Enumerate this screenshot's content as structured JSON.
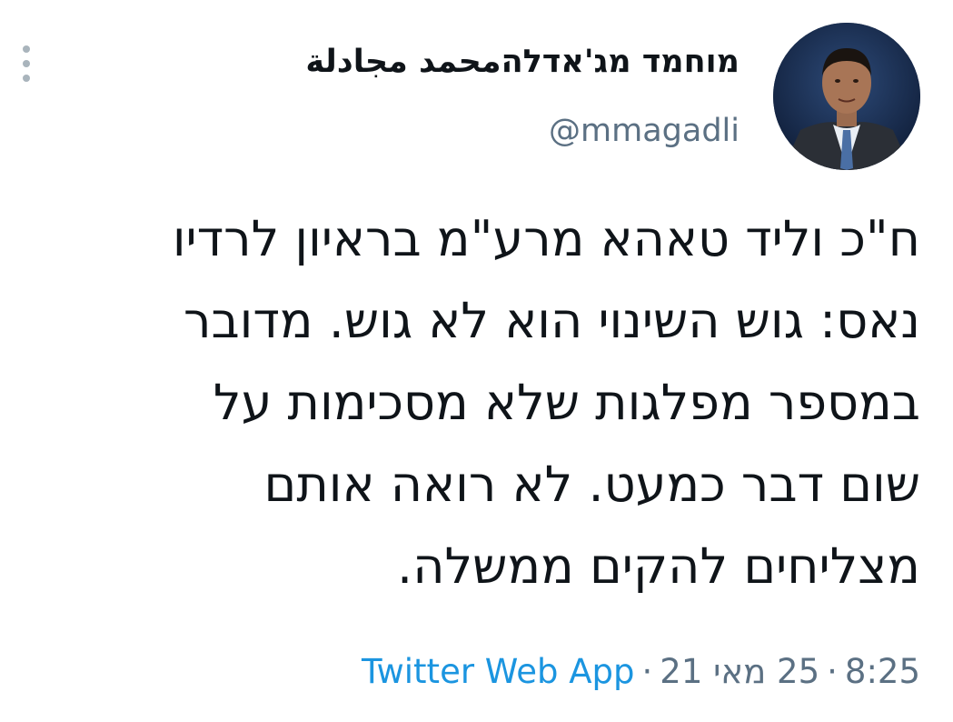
{
  "user": {
    "display_name": "מוחמד מג'אדלה",
    "display_name_arabic": "محمد مجادلة",
    "handle": "@mmagadli"
  },
  "tweet": {
    "lines": [
      "ח\"כ וליד טאהא מרע\"מ בראיון לרדיו",
      "נאס: גוש השינוי הוא לא גוש. מדובר",
      "במספר מפלגות שלא מסכימות על",
      "שום דבר כמעט. לא רואה אותם",
      "מצליחים להקים ממשלה."
    ]
  },
  "meta": {
    "time": "8:25",
    "separator": "·",
    "date": "25 מאי 21",
    "source": "Twitter Web App"
  },
  "icons": {
    "more": "more-vertical-icon"
  },
  "colors": {
    "text": "#0f1419",
    "secondary": "#5b7083",
    "link": "#1b95e0"
  }
}
